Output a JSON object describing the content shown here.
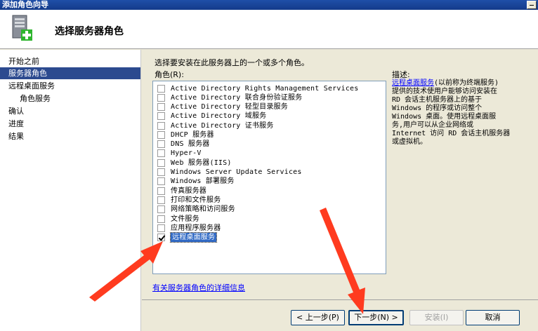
{
  "window": {
    "title": "添加角色向导"
  },
  "header": {
    "title": "选择服务器角色"
  },
  "nav": {
    "items": [
      {
        "label": "开始之前",
        "active": false,
        "sub": false
      },
      {
        "label": "服务器角色",
        "active": true,
        "sub": false
      },
      {
        "label": "远程桌面服务",
        "active": false,
        "sub": false
      },
      {
        "label": "角色服务",
        "active": false,
        "sub": true
      },
      {
        "label": "确认",
        "active": false,
        "sub": false
      },
      {
        "label": "进度",
        "active": false,
        "sub": false
      },
      {
        "label": "结果",
        "active": false,
        "sub": false
      }
    ]
  },
  "content": {
    "instruction": "选择要安装在此服务器上的一个或多个角色。",
    "roles_label": "角色(R):",
    "description_label": "描述:",
    "roles": [
      {
        "label": "Active Directory Rights Management Services",
        "checked": false
      },
      {
        "label": "Active Directory 联合身份验证服务",
        "checked": false
      },
      {
        "label": "Active Directory 轻型目录服务",
        "checked": false
      },
      {
        "label": "Active Directory 域服务",
        "checked": false
      },
      {
        "label": "Active Directory 证书服务",
        "checked": false
      },
      {
        "label": "DHCP 服务器",
        "checked": false
      },
      {
        "label": "DNS 服务器",
        "checked": false
      },
      {
        "label": "Hyper-V",
        "checked": false
      },
      {
        "label": "Web 服务器(IIS)",
        "checked": false
      },
      {
        "label": "Windows Server Update Services",
        "checked": false
      },
      {
        "label": "Windows 部署服务",
        "checked": false
      },
      {
        "label": "传真服务器",
        "checked": false
      },
      {
        "label": "打印和文件服务",
        "checked": false
      },
      {
        "label": "网络策略和访问服务",
        "checked": false
      },
      {
        "label": "文件服务",
        "checked": false
      },
      {
        "label": "应用程序服务器",
        "checked": false
      },
      {
        "label": "远程桌面服务",
        "checked": true
      }
    ],
    "description": {
      "link": "远程桌面服务",
      "lines": [
        "(以前称为终端服务)",
        "提供的技术使用户能够访问安装在",
        "RD 会话主机服务器上的基于",
        "Windows 的程序或访问整个",
        "Windows 桌面。使用远程桌面服",
        "务,用户可以从企业网络或",
        "Internet 访问 RD 会话主机服务器",
        "或虚拟机。"
      ]
    },
    "more_info_link": "有关服务器角色的详细信息"
  },
  "footer": {
    "back_label": "< 上一步(P)",
    "next_label": "下一步(N) >",
    "install_label": "安装(I)",
    "cancel_label": "取消"
  },
  "colors": {
    "arrow": "#ff3b1f",
    "selection": "#316ac5",
    "nav_active": "#2c4a8f"
  }
}
